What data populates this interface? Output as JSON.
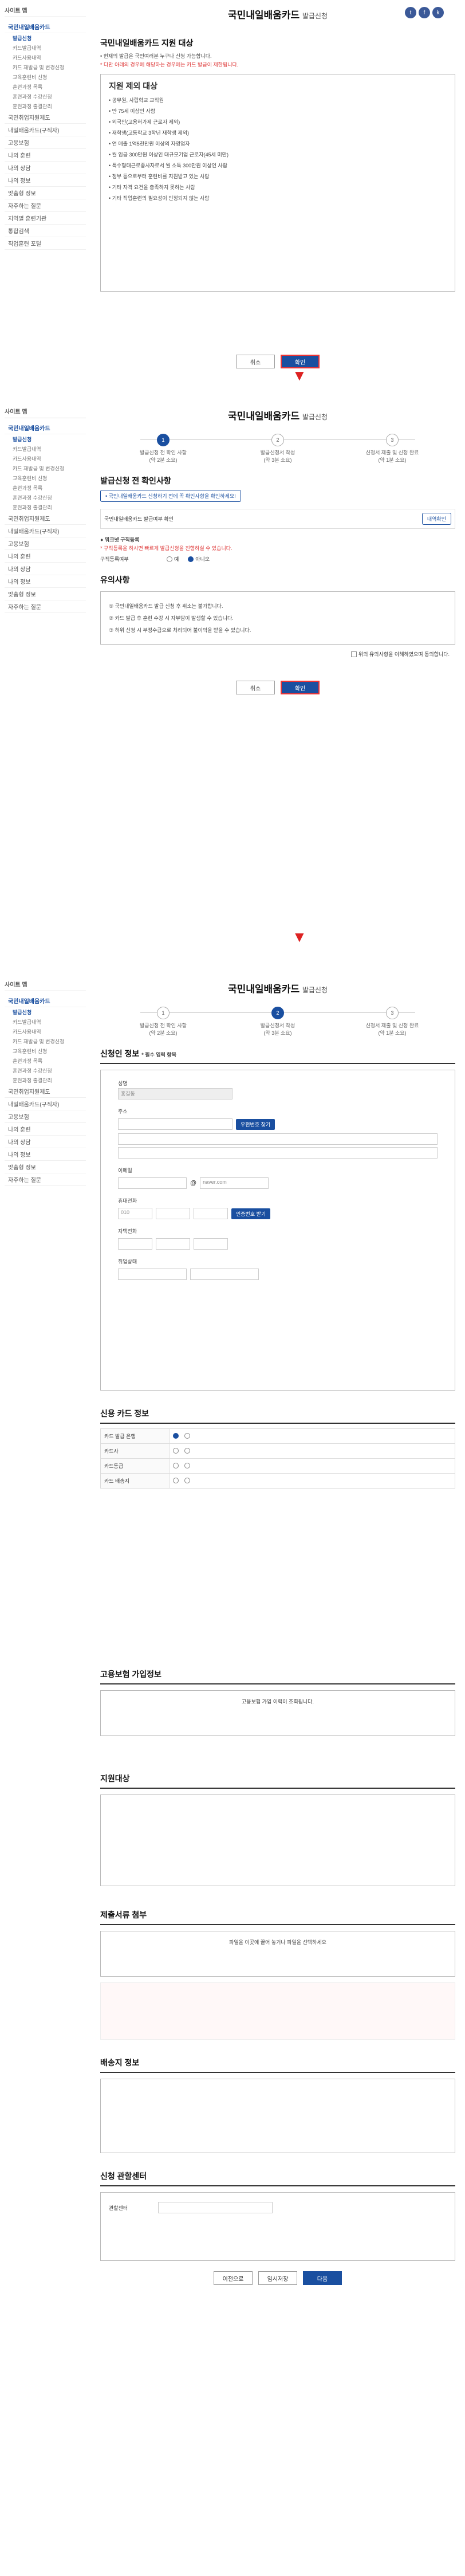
{
  "sidebar": {
    "top": "사이트 맵",
    "items": [
      "국민내일배움카드",
      "발급신청",
      "카드발급내역",
      "카드사용내역",
      "카드 재발급 및 변경신청",
      "교육훈련비 신청",
      "훈련과정 목록",
      "훈련과정 수강신청",
      "훈련과정 출결관리",
      "국민취업지원제도",
      "내일배움카드(구직자)",
      "고용보험",
      "나의 훈련",
      "나의 상담",
      "나의 정보",
      "맞춤형 정보",
      "자주하는 질문",
      "지역별 훈련기관",
      "통합검색",
      "직업훈련 포털"
    ]
  },
  "title": "국민내일배움카드",
  "title_sub": "발급신청",
  "share": [
    "t",
    "f",
    "k"
  ],
  "p1": {
    "heading": "국민내일배움카드 지원 대상",
    "note1": "• 현재의 발급은 국민여러분 누구나 신청 가능합니다.",
    "note2": "* 다만 아래의 경우에 해당하는 경우에는 카드 발급이 제한됩니다.",
    "box_title": "지원 제외 대상",
    "items": [
      "• 공무원, 사립학교 교직원",
      "• 만 75세 이상인 사람",
      "• 외국인(고용허가제 근로자 제외)",
      "• 재학생(고등학교 3학년 재학생 제외)",
      "• 연 매출 1억5천만원 이상의 자영업자",
      "• 월 임금 300만원 이상인 대규모기업 근로자(45세 미만)",
      "• 특수형태근로종사자로서 월 소득 300만원 이상인 사람",
      "• 정부 등으로부터 훈련비를 지원받고 있는 사람",
      "• 기타 자격 요건을 충족하지 못하는 사람",
      "• 기타 직업훈련의 필요성이 인정되지 않는 사람"
    ],
    "cancel": "취소",
    "confirm": "확인"
  },
  "steps": [
    {
      "n": "1",
      "t": "발급신청 전 확인 사항",
      "d": "(약 2분 소요)"
    },
    {
      "n": "2",
      "t": "발급신청서 작성",
      "d": "(약 3분 소요)"
    },
    {
      "n": "3",
      "t": "신청서 제출 및 신청 완료",
      "d": "(약 1분 소요)"
    }
  ],
  "p2": {
    "heading": "발급신청 전 확인사항",
    "note1": "• 국민내일배움카드 신청하기 전에 꼭 확인사항을 확인하세요!",
    "check_label": "국민내일배움카드 발급여부 확인",
    "check_btn": "내역확인",
    "sub_heading": "● 워크넷 구직등록",
    "sub_note": "* 구직등록을 하시면 빠르게 발급신청을 진행하실 수 있습니다.",
    "reg_label": "구직등록여부",
    "radio_y": "예",
    "radio_n": "아니오",
    "caution_title": "유의사항",
    "cautions": [
      "① 국민내일배움카드 발급 신청 후 취소는 불가합니다.",
      "② 카드 발급 후 훈련 수강 시 자부담이 발생할 수 있습니다.",
      "③ 허위 신청 시 부정수급으로 처리되어 불이익을 받을 수 있습니다."
    ],
    "agree": "위의 유의사항을 이해하였으며 동의합니다.",
    "cancel": "취소",
    "confirm": "확인"
  },
  "p3": {
    "sec1": "신청인 정보",
    "req": "* 필수 입력 항목",
    "name_label": "성명",
    "name_val": "홍길동",
    "addr_label": "주소",
    "addr_btn": "우편번호 찾기",
    "email_label": "이메일",
    "email_domain": "naver.com",
    "phone_label": "휴대전화",
    "phone_prefix": "010",
    "cert_btn": "인증번호 받기",
    "tel_label": "자택전화",
    "job_label": "취업상태",
    "sec2": "신용 카드 정보",
    "card_rows": [
      "카드 발급 은행",
      "카드사",
      "카드등급",
      "카드 배송지"
    ],
    "sec3": "고용보험 가입정보",
    "insurance_note": "고용보험 가입 이력이 조회됩니다.",
    "sec4": "지원대상",
    "sec5": "제출서류 첨부",
    "upload_note": "파일을 이곳에 끌어 놓거나 파일을 선택하세요",
    "sec6": "배송지 정보",
    "sec7": "신청 관할센터",
    "center_label": "관할센터",
    "btn_prev": "이전으로",
    "btn_save": "임시저장",
    "btn_next": "다음"
  }
}
